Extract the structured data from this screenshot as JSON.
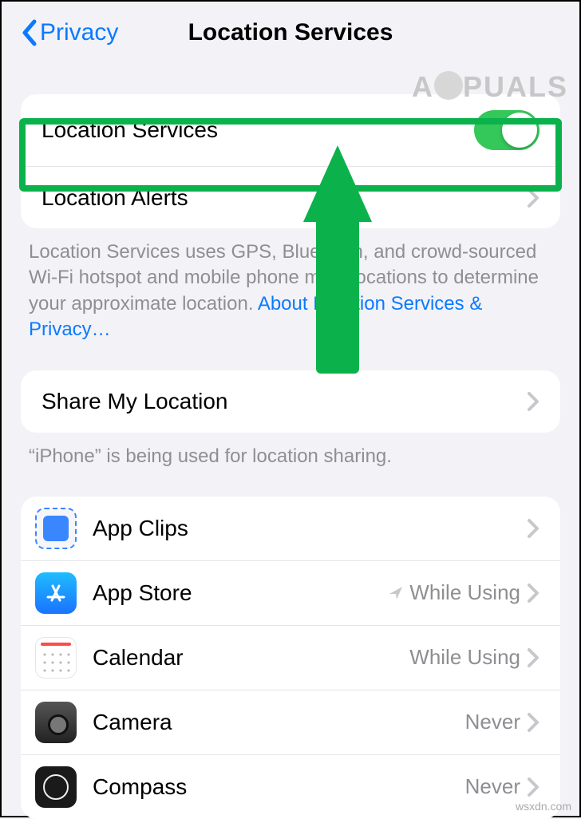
{
  "header": {
    "back_label": "Privacy",
    "title": "Location Services"
  },
  "watermark": {
    "top_left": "A",
    "top_right": "PUALS",
    "bottom": "wsxdn.com"
  },
  "group_services": {
    "location_services_label": "Location Services",
    "location_alerts_label": "Location Alerts"
  },
  "services_footer": {
    "text": "Location Services uses GPS, Bluetooth, and crowd-sourced Wi-Fi hotspot and mobile phone mast locations to determine your approximate location.",
    "link": "About Location Services & Privacy…"
  },
  "share": {
    "label": "Share My Location",
    "footer": "“iPhone” is being used for location sharing."
  },
  "apps": [
    {
      "name": "App Clips",
      "value": "",
      "icon": "appclips",
      "loc": false
    },
    {
      "name": "App Store",
      "value": "While Using",
      "icon": "appstore",
      "loc": true
    },
    {
      "name": "Calendar",
      "value": "While Using",
      "icon": "calendar",
      "loc": false
    },
    {
      "name": "Camera",
      "value": "Never",
      "icon": "camera",
      "loc": false
    },
    {
      "name": "Compass",
      "value": "Never",
      "icon": "compass",
      "loc": false
    }
  ]
}
